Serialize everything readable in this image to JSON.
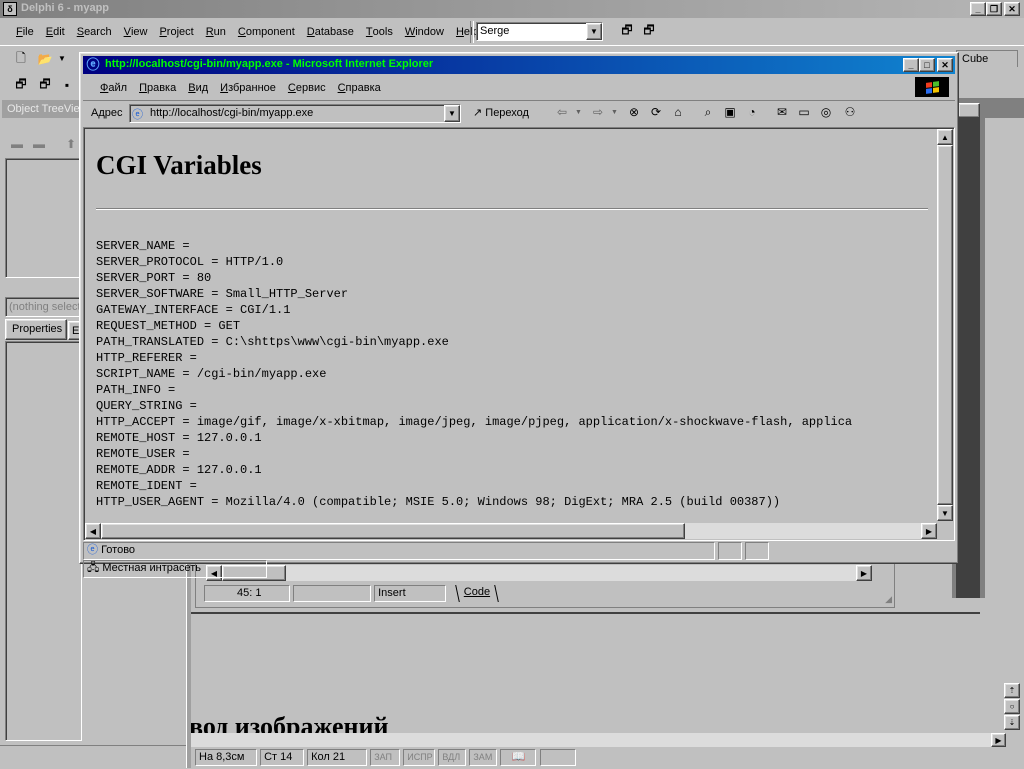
{
  "delphi": {
    "title": "Delphi 6 - myapp",
    "menu": [
      {
        "u": "F",
        "rest": "ile"
      },
      {
        "u": "E",
        "rest": "dit"
      },
      {
        "u": "S",
        "rest": "earch"
      },
      {
        "u": "V",
        "rest": "iew"
      },
      {
        "u": "P",
        "rest": "roject"
      },
      {
        "u": "R",
        "rest": "un"
      },
      {
        "u": "C",
        "rest": "omponent"
      },
      {
        "u": "D",
        "rest": "atabase"
      },
      {
        "u": "T",
        "rest": "ools"
      },
      {
        "u": "W",
        "rest": "indow"
      },
      {
        "u": "H",
        "rest": "elp"
      }
    ],
    "desktop_combo": "Serge",
    "palette_tab_right": "Cube",
    "object_treeview_label": "Object TreeVie",
    "inspector_combo": "(nothing select",
    "inspector_tabs": [
      "Properties",
      "E"
    ],
    "editor_status": {
      "position": "45:   1",
      "mode": "Insert",
      "tab": "Code"
    },
    "doc_heading": "вод изображений",
    "doc_status": [
      "На 8,3см",
      "Ст 14",
      "Кол 21",
      "ЗАП",
      "ИСПР",
      "ВДЛ",
      "ЗАМ"
    ]
  },
  "ie": {
    "title": "http://localhost/cgi-bin/myapp.exe - Microsoft Internet Explorer",
    "menu": [
      {
        "u": "Ф",
        "rest": "айл"
      },
      {
        "u": "П",
        "rest": "равка"
      },
      {
        "u": "В",
        "rest": "ид"
      },
      {
        "u": "И",
        "rest": "збранное"
      },
      {
        "u": "С",
        "rest": "ервис"
      },
      {
        "u": "С",
        "rest": "правка"
      }
    ],
    "address_label": "Адрес",
    "address_value": "http://localhost/cgi-bin/myapp.exe",
    "go_label": "Переход",
    "status_text": "Готово",
    "zone_text": "Местная интрасеть"
  },
  "page": {
    "heading": "CGI Variables",
    "variables": [
      "SERVER_NAME =",
      "SERVER_PROTOCOL = HTTP/1.0",
      "SERVER_PORT = 80",
      "SERVER_SOFTWARE = Small_HTTP_Server",
      "GATEWAY_INTERFACE = CGI/1.1",
      "REQUEST_METHOD = GET",
      "PATH_TRANSLATED = C:\\shttps\\www\\cgi-bin\\myapp.exe",
      "HTTP_REFERER =",
      "SCRIPT_NAME = /cgi-bin/myapp.exe",
      "PATH_INFO =",
      "QUERY_STRING =",
      "HTTP_ACCEPT = image/gif, image/x-xbitmap, image/jpeg, image/pjpeg, application/x-shockwave-flash, applica",
      "REMOTE_HOST = 127.0.0.1",
      "REMOTE_USER =",
      "REMOTE_ADDR = 127.0.0.1",
      "REMOTE_IDENT =",
      "HTTP_USER_AGENT = Mozilla/4.0 (compatible; MSIE 5.0; Windows 98; DigExt; MRA 2.5 (build 00387))"
    ]
  }
}
